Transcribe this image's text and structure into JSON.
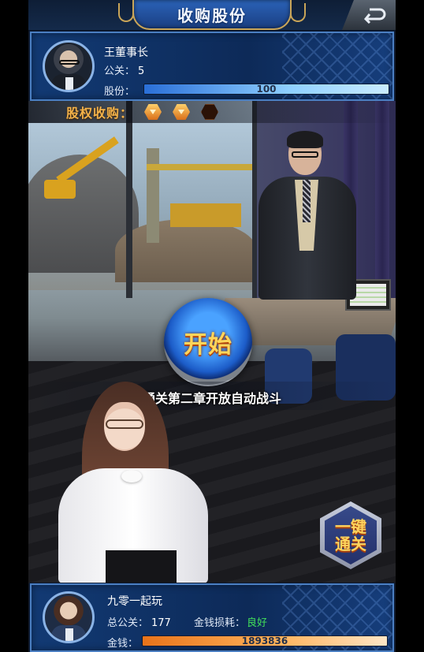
{
  "header": {
    "title": "收购股份",
    "back_icon": "back-arrow-icon"
  },
  "top_player": {
    "name": "王董事长",
    "level_label": "公关：",
    "level_value": "5",
    "shares_label": "股份：",
    "shares_value": "100",
    "shares_progress": 1.0
  },
  "acquisition": {
    "label": "股权收购：",
    "stars_total": 3,
    "stars_filled": 2
  },
  "main": {
    "start_label": "开始",
    "notice": "通关第二章开放自动战斗",
    "auto_clear_line1": "一键",
    "auto_clear_line2": "通关"
  },
  "bottom_player": {
    "name": "九零一起玩",
    "total_level_label": "总公关：",
    "total_level_value": "177",
    "money_loss_label": "金钱损耗：",
    "money_loss_value": "良好",
    "money_label": "金钱：",
    "money_value": "1893836",
    "money_progress": 1.0
  },
  "colors": {
    "accent_blue": "#2b63b8",
    "gold": "#c9a558",
    "good_green": "#42e05a",
    "star_orange": "#f3b24a"
  }
}
